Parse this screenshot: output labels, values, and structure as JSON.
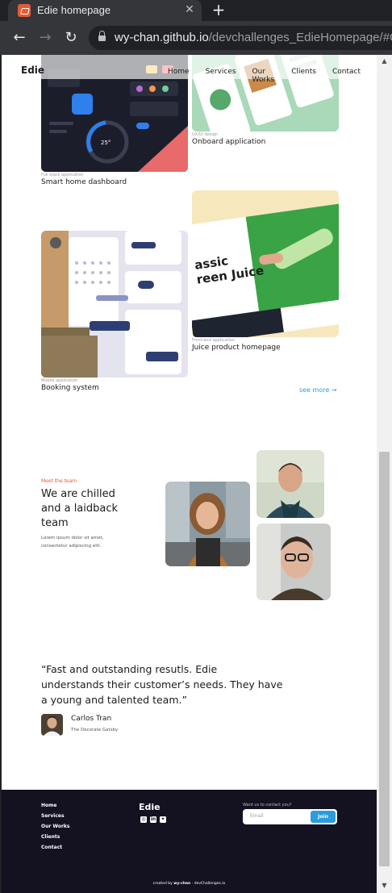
{
  "browser": {
    "tab_title": "Edie homepage",
    "tab_close": "✕",
    "new_tab": "+",
    "url_host": "wy-chan.github.io",
    "url_path": "/devchallenges_EdieHomepage/#Clie"
  },
  "header": {
    "logo": "Edie",
    "nav": [
      "Home",
      "Services",
      "Our Works",
      "Clients",
      "Contact"
    ]
  },
  "projects": [
    {
      "category": "Full stack application",
      "title": "Smart home dashboard"
    },
    {
      "category": "UX/UI design",
      "title": "Onboard application"
    },
    {
      "category": "Mobile application",
      "title": "Booking system"
    },
    {
      "category": "Front-end application",
      "title": "Juice product homepage"
    }
  ],
  "juice_image": {
    "line1": "assic",
    "line2": "reen Juice"
  },
  "see_more": "see more →",
  "team": {
    "tag": "Meet the team",
    "title": "We are chilled and a laidback team",
    "description": "Lorem ipsum dolor sit amet, consectetur adipiscing elit."
  },
  "testimonial": {
    "quote": "“Fast and outstanding resutls. Edie understands their customer’s needs. They have a young and talented team.”",
    "author": "Carlos Tran",
    "company": "The Decorate Gatsby"
  },
  "footer": {
    "links": [
      "Home",
      "Services",
      "Our Works",
      "Clients",
      "Contact"
    ],
    "logo": "Edie",
    "contact_label": "Want us to contact you?",
    "email_placeholder": "Email",
    "join_label": "Join",
    "credit_prefix": "created by ",
    "credit_author": "wy-chan",
    "credit_suffix": " - devChallenges.io"
  },
  "colors": {
    "accent": "#2d9cdb",
    "tag": "#e85a34",
    "footer_bg": "#141121"
  }
}
